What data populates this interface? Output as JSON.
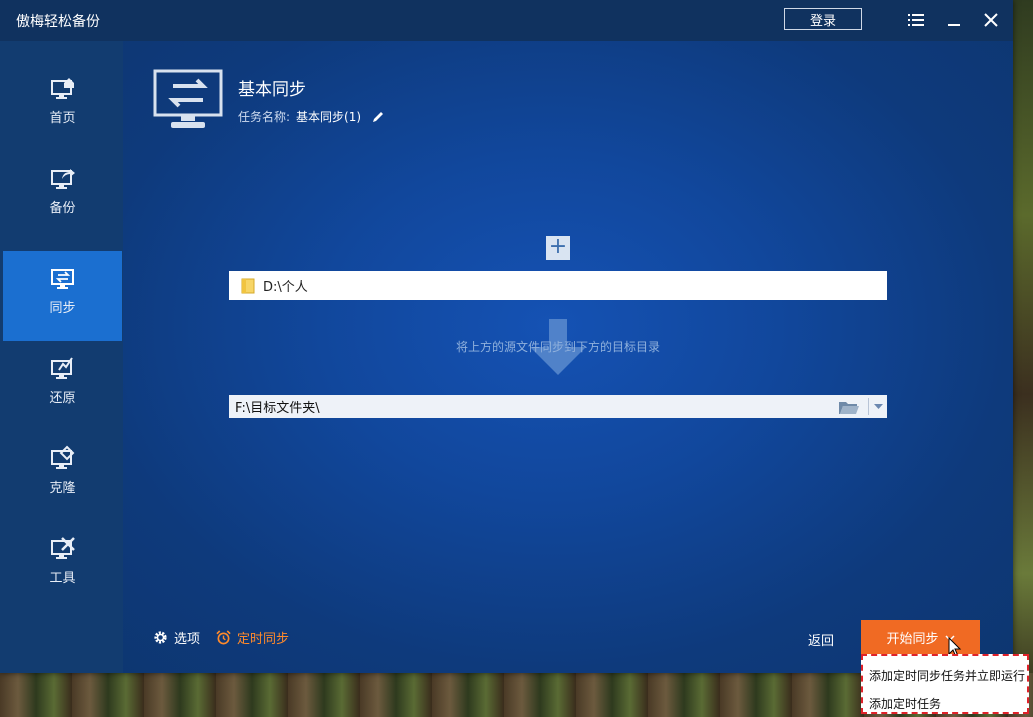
{
  "titlebar": {
    "app_title": "傲梅轻松备份",
    "login_label": "登录",
    "icons": [
      "menu-icon",
      "minimize-icon",
      "close-icon"
    ]
  },
  "sidebar": {
    "items": [
      {
        "label": "首页",
        "icon": "home-icon",
        "active": false
      },
      {
        "label": "备份",
        "icon": "backup-icon",
        "active": false
      },
      {
        "label": "同步",
        "icon": "sync-icon",
        "active": true
      },
      {
        "label": "还原",
        "icon": "restore-icon",
        "active": false
      },
      {
        "label": "克隆",
        "icon": "clone-icon",
        "active": false
      },
      {
        "label": "工具",
        "icon": "tools-icon",
        "active": false
      }
    ]
  },
  "header": {
    "title": "基本同步",
    "task_name_label": "任务名称:",
    "task_name_value": "基本同步(1)"
  },
  "source": {
    "plus_label": "+",
    "path": "D:\\个人"
  },
  "hint": "将上方的源文件同步到下方的目标目录",
  "destination": {
    "path": "F:\\目标文件夹\\"
  },
  "footer": {
    "options_label": "选项",
    "schedule_label": "定时同步",
    "back_label": "返回",
    "start_label": "开始同步"
  },
  "start_menu": {
    "items": [
      "添加定时同步任务并立即运行",
      "添加定时任务"
    ]
  },
  "colors": {
    "accent_orange": "#f06a23",
    "sidebar_active": "#1b6fd0",
    "schedule_text": "#ff8a2b",
    "dropdown_border": "#e0222a"
  }
}
